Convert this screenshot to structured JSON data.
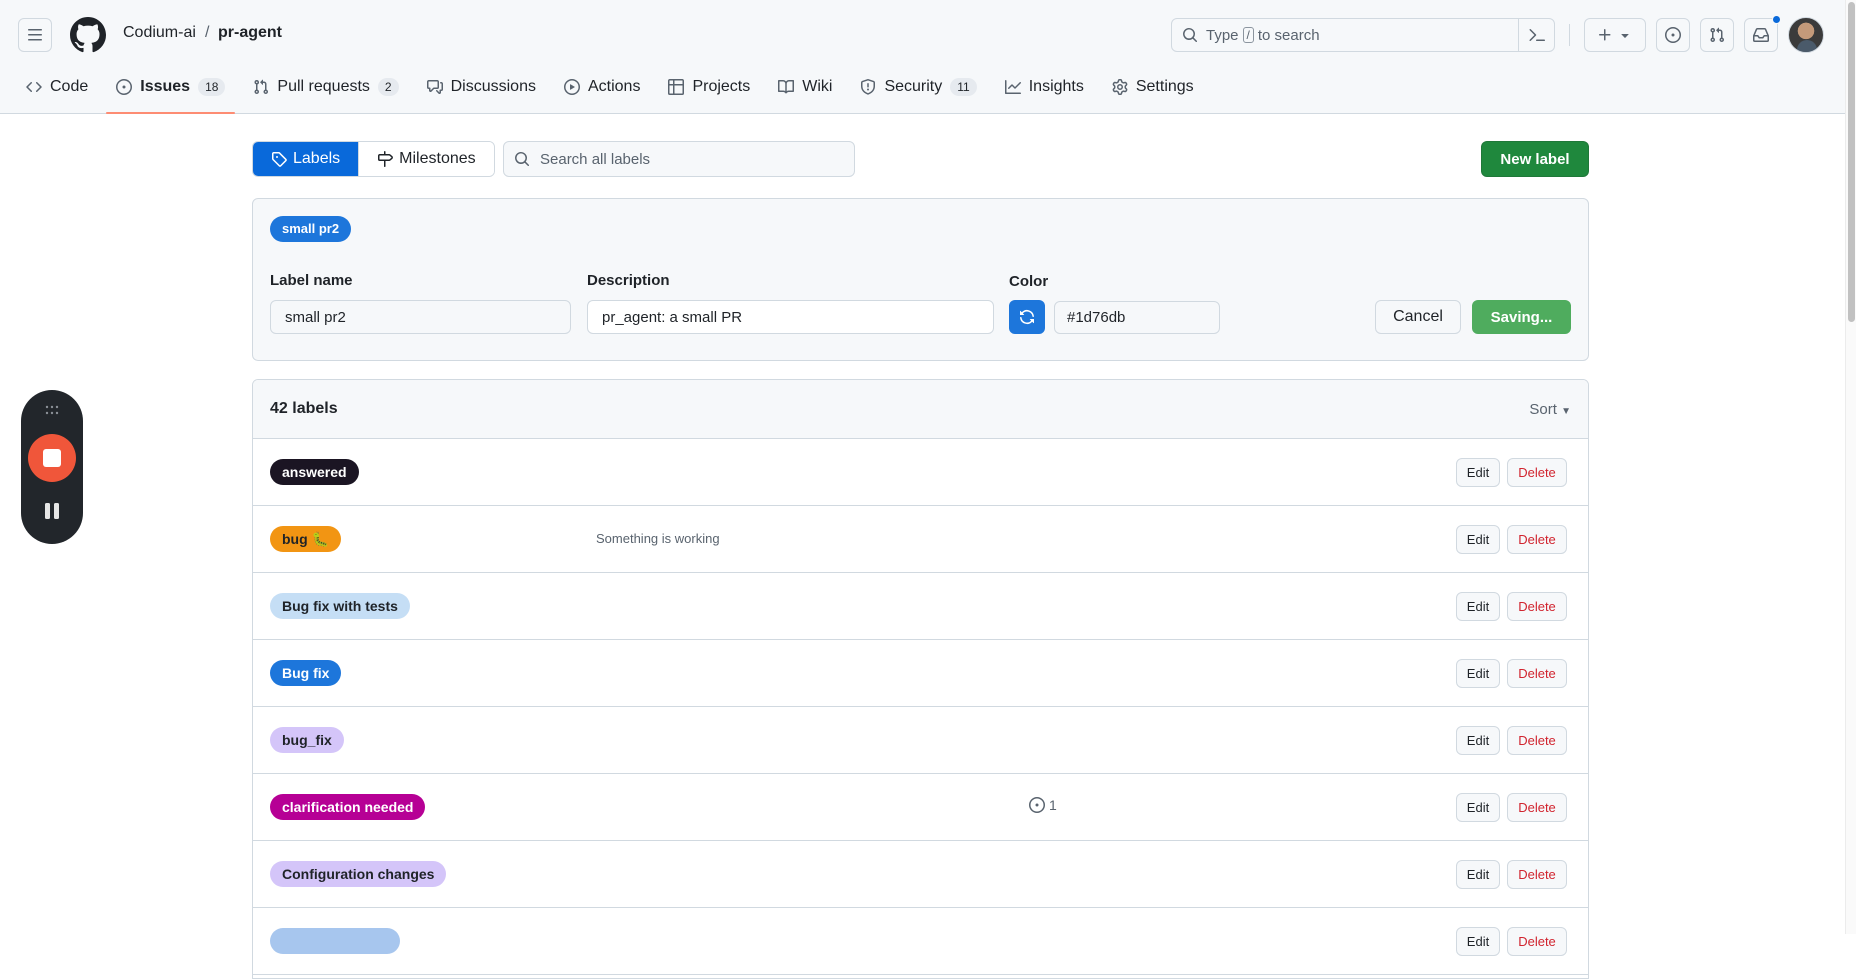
{
  "header": {
    "owner": "Codium-ai",
    "separator": "/",
    "repo": "pr-agent",
    "search_prefix": "Type",
    "search_key": "/",
    "search_suffix": "to search"
  },
  "repo_nav": [
    {
      "label": "Code",
      "icon": "code-icon"
    },
    {
      "label": "Issues",
      "icon": "issue-opened-icon",
      "count": "18",
      "selected": true
    },
    {
      "label": "Pull requests",
      "icon": "git-pull-request-icon",
      "count": "2"
    },
    {
      "label": "Discussions",
      "icon": "comment-discussion-icon"
    },
    {
      "label": "Actions",
      "icon": "play-icon"
    },
    {
      "label": "Projects",
      "icon": "table-icon"
    },
    {
      "label": "Wiki",
      "icon": "book-icon"
    },
    {
      "label": "Security",
      "icon": "shield-icon",
      "count": "11"
    },
    {
      "label": "Insights",
      "icon": "graph-icon"
    },
    {
      "label": "Settings",
      "icon": "gear-icon"
    }
  ],
  "subnav": {
    "labels": "Labels",
    "milestones": "Milestones",
    "search_placeholder": "Search all labels",
    "new_label": "New label"
  },
  "edit_form": {
    "preview_label": "small pr2",
    "preview_color": "#1d76db",
    "name_label": "Label name",
    "name_value": "small pr2",
    "description_label": "Description",
    "description_value": "pr_agent: a small PR",
    "color_label": "Color",
    "color_value": "#1d76db",
    "cancel": "Cancel",
    "saving": "Saving..."
  },
  "list": {
    "count": "42 labels",
    "sort": "Sort",
    "edit": "Edit",
    "delete": "Delete",
    "rows": [
      {
        "name": "answered",
        "bg": "#1b1523",
        "fg": "#ffffff",
        "description": "",
        "issues": ""
      },
      {
        "name": "bug 🐛",
        "bg": "#f29513",
        "fg": "#1f2328",
        "description": "Something is working",
        "issues": ""
      },
      {
        "name": "Bug fix with tests",
        "bg": "#c5def5",
        "fg": "#1f2328",
        "description": "",
        "issues": ""
      },
      {
        "name": "Bug fix",
        "bg": "#1d76db",
        "fg": "#ffffff",
        "description": "",
        "issues": ""
      },
      {
        "name": "bug_fix",
        "bg": "#d4c5f9",
        "fg": "#1f2328",
        "description": "",
        "issues": ""
      },
      {
        "name": "clarification needed",
        "bg": "#b60095",
        "fg": "#ffffff",
        "description": "",
        "issues": "1"
      },
      {
        "name": "Configuration changes",
        "bg": "#d4c5f9",
        "fg": "#1f2328",
        "description": "",
        "issues": ""
      },
      {
        "name": "",
        "bg": "#a7c6ee",
        "fg": "#1f2328",
        "description": "",
        "issues": ""
      }
    ]
  }
}
